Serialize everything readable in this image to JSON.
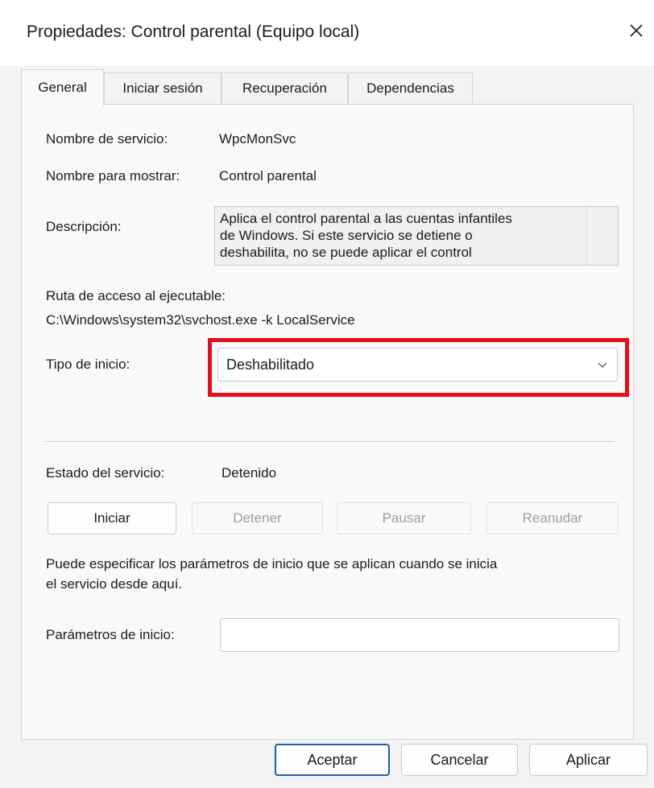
{
  "window": {
    "title": "Propiedades: Control parental (Equipo local)",
    "close_icon": "close-icon"
  },
  "tabs": [
    {
      "label": "General",
      "active": true
    },
    {
      "label": "Iniciar sesión",
      "active": false
    },
    {
      "label": "Recuperación",
      "active": false
    },
    {
      "label": "Dependencias",
      "active": false
    }
  ],
  "general": {
    "service_name_label": "Nombre de servicio:",
    "service_name_value": "WpcMonSvc",
    "display_name_label": "Nombre para mostrar:",
    "display_name_value": "Control parental",
    "description_label": "Descripción:",
    "description_lines": [
      "Aplica el control parental a las cuentas infantiles",
      "de Windows. Si este servicio se detiene o",
      "deshabilita, no se puede aplicar el control"
    ],
    "path_label": "Ruta de acceso al ejecutable:",
    "path_value": "C:\\Windows\\system32\\svchost.exe -k LocalService",
    "startup_type_label": "Tipo de inicio:",
    "startup_type_value": "Deshabilitado",
    "service_status_label": "Estado del servicio:",
    "service_status_value": "Detenido",
    "buttons": {
      "start": "Iniciar",
      "stop": "Detener",
      "pause": "Pausar",
      "resume": "Reanudar"
    },
    "hint_line1": "Puede especificar los parámetros de inicio que se aplican cuando se inicia",
    "hint_line2": "el servicio desde aquí.",
    "start_params_label": "Parámetros de inicio:",
    "start_params_value": ""
  },
  "footer": {
    "ok": "Aceptar",
    "cancel": "Cancelar",
    "apply": "Aplicar"
  },
  "colors": {
    "highlight": "#e3101d",
    "default_button_border": "#1f5fa8"
  }
}
